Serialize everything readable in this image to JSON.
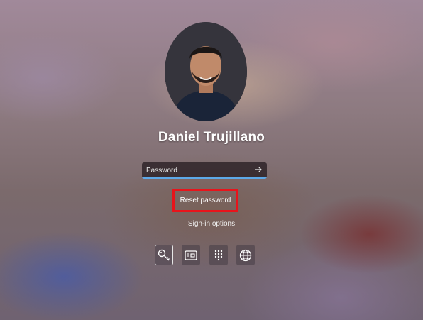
{
  "user": {
    "name": "Daniel Trujillano"
  },
  "password": {
    "placeholder": "Password",
    "value": ""
  },
  "links": {
    "reset": "Reset password",
    "signin_options": "Sign-in options"
  },
  "signin_methods": [
    {
      "icon": "key-icon",
      "selected": true
    },
    {
      "icon": "smart-card-icon",
      "selected": false
    },
    {
      "icon": "pin-keypad-icon",
      "selected": false
    },
    {
      "icon": "globe-icon",
      "selected": false
    }
  ],
  "colors": {
    "focus_underline": "#5da9e9",
    "highlight_box": "#e8141b"
  }
}
